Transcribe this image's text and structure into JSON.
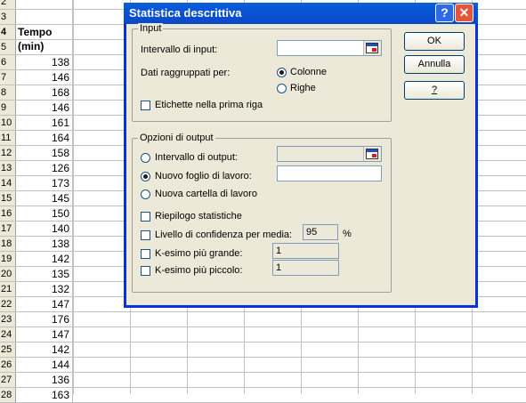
{
  "sheet": {
    "rows": [
      {
        "num": "2",
        "val": ""
      },
      {
        "num": "3",
        "val": ""
      },
      {
        "num": "4",
        "val": "Tempo (min)",
        "header": true
      },
      {
        "num": "5",
        "val": ""
      },
      {
        "num": "6",
        "val": "138"
      },
      {
        "num": "7",
        "val": "146"
      },
      {
        "num": "8",
        "val": "168"
      },
      {
        "num": "9",
        "val": "146"
      },
      {
        "num": "10",
        "val": "161"
      },
      {
        "num": "11",
        "val": "164"
      },
      {
        "num": "12",
        "val": "158"
      },
      {
        "num": "13",
        "val": "126"
      },
      {
        "num": "14",
        "val": "173"
      },
      {
        "num": "15",
        "val": "145"
      },
      {
        "num": "16",
        "val": "150"
      },
      {
        "num": "17",
        "val": "140"
      },
      {
        "num": "18",
        "val": "138"
      },
      {
        "num": "19",
        "val": "142"
      },
      {
        "num": "20",
        "val": "135"
      },
      {
        "num": "21",
        "val": "132"
      },
      {
        "num": "22",
        "val": "147"
      },
      {
        "num": "23",
        "val": "176"
      },
      {
        "num": "24",
        "val": "147"
      },
      {
        "num": "25",
        "val": "142"
      },
      {
        "num": "26",
        "val": "144"
      },
      {
        "num": "27",
        "val": "136"
      },
      {
        "num": "28",
        "val": "163"
      }
    ]
  },
  "dialog": {
    "title": "Statistica descrittiva",
    "help_glyph": "?",
    "close_glyph": "✕",
    "input": {
      "group_label": "Input",
      "range_label": "Intervallo di input:",
      "range_value": "",
      "grouped_label": "Dati raggruppati per:",
      "columns_label": "Colonne",
      "rows_label": "Righe",
      "labels_first_row": "Etichette nella prima riga"
    },
    "output": {
      "group_label": "Opzioni di output",
      "output_range_label": "Intervallo di output:",
      "new_sheet_label": "Nuovo foglio di lavoro:",
      "new_sheet_value": "",
      "new_workbook_label": "Nuova cartella di lavoro",
      "summary_label": "Riepilogo statistiche",
      "confidence_label": "Livello di confidenza per media:",
      "confidence_value": "95",
      "confidence_unit": "%",
      "kth_largest_label": "K-esimo più grande:",
      "kth_largest_value": "1",
      "kth_smallest_label": "K-esimo più piccolo:",
      "kth_smallest_value": "1"
    },
    "buttons": {
      "ok": "OK",
      "cancel": "Annulla",
      "help": "?"
    }
  },
  "colors": {
    "title_bar": "#0a5fd8",
    "dialog_bg": "#ece9d8",
    "close_button": "#e4553a"
  }
}
